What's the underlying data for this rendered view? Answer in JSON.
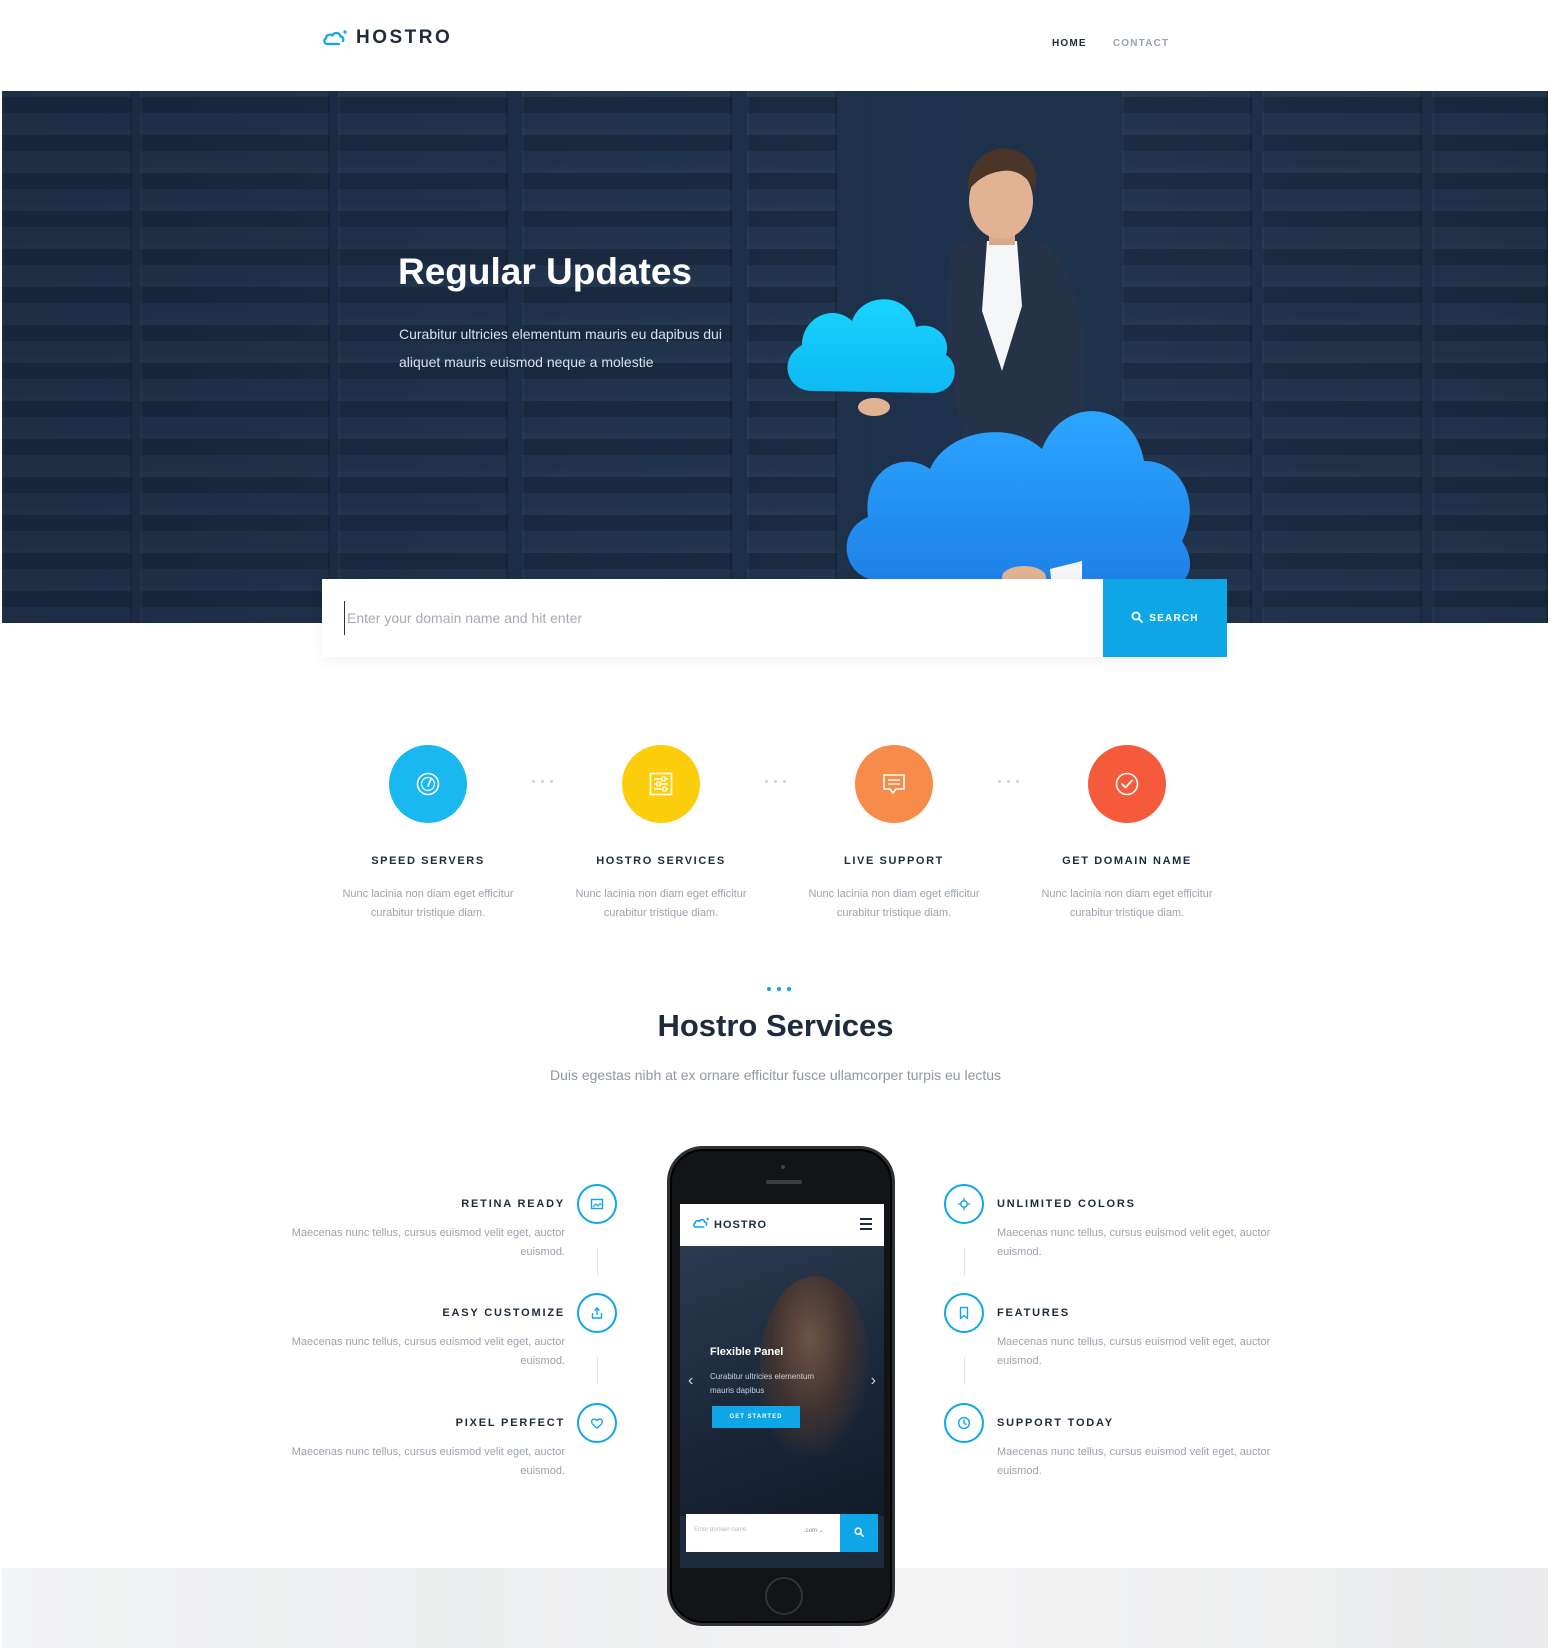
{
  "header": {
    "logo_text": "HOSTRO",
    "nav": [
      {
        "label": "HOME",
        "active": true
      },
      {
        "label": "CONTACT",
        "active": false
      }
    ]
  },
  "hero": {
    "title": "Regular Updates",
    "text": "Curabitur ultricies elementum mauris eu dapibus dui aliquet  mauris euismod neque a molestie"
  },
  "search": {
    "placeholder": "Enter your domain name and hit enter",
    "button_label": "SEARCH",
    "button_icon": "search-icon"
  },
  "features": [
    {
      "title": "SPEED SERVERS",
      "desc": "Nunc lacinia non diam eget efficitur curabitur tristique diam.",
      "color": "#1ab8f0",
      "icon": "speedometer-icon"
    },
    {
      "title": "HOSTRO SERVICES",
      "desc": "Nunc lacinia non diam eget efficitur curabitur tristique diam.",
      "color": "#fccd0a",
      "icon": "sliders-icon"
    },
    {
      "title": "LIVE SUPPORT",
      "desc": "Nunc lacinia non diam eget efficitur curabitur tristique diam.",
      "color": "#f78c4a",
      "icon": "chat-icon"
    },
    {
      "title": "GET DOMAIN NAME",
      "desc": "Nunc lacinia non diam eget efficitur curabitur tristique diam.",
      "color": "#f55a3b",
      "icon": "check-circle-icon"
    }
  ],
  "services": {
    "title": "Hostro Services",
    "subtitle": "Duis egestas nibh at ex ornare efficitur fusce ullamcorper turpis eu lectus",
    "left": [
      {
        "title": "RETINA READY",
        "desc": "Maecenas nunc tellus, cursus euismod velit eget, auctor euismod.",
        "icon": "image-icon"
      },
      {
        "title": "EASY CUSTOMIZE",
        "desc": "Maecenas nunc tellus, cursus euismod velit eget, auctor euismod.",
        "icon": "share-icon"
      },
      {
        "title": "PIXEL PERFECT",
        "desc": "Maecenas nunc tellus, cursus euismod velit eget, auctor euismod.",
        "icon": "heart-icon"
      }
    ],
    "right": [
      {
        "title": "UNLIMITED COLORS",
        "desc": "Maecenas nunc tellus, cursus euismod velit eget, auctor euismod.",
        "icon": "crosshair-icon"
      },
      {
        "title": "FEATURES",
        "desc": "Maecenas nunc tellus, cursus euismod velit eget, auctor euismod.",
        "icon": "bookmark-icon"
      },
      {
        "title": "SUPPORT TODAY",
        "desc": "Maecenas nunc tellus, cursus euismod velit eget, auctor euismod.",
        "icon": "clock-icon"
      }
    ]
  },
  "phone": {
    "logo_text": "HOSTRO",
    "slide_title": "Flexible Panel",
    "slide_text": "Curabitur ultricies elementum mauris dapibus",
    "button_label": "GET STARTED",
    "search_placeholder": "Enter domain name",
    "tld": ".com ⌄"
  },
  "colors": {
    "accent": "#0fa6e8",
    "dark": "#1d2b3c",
    "muted": "#9aa3ad"
  }
}
